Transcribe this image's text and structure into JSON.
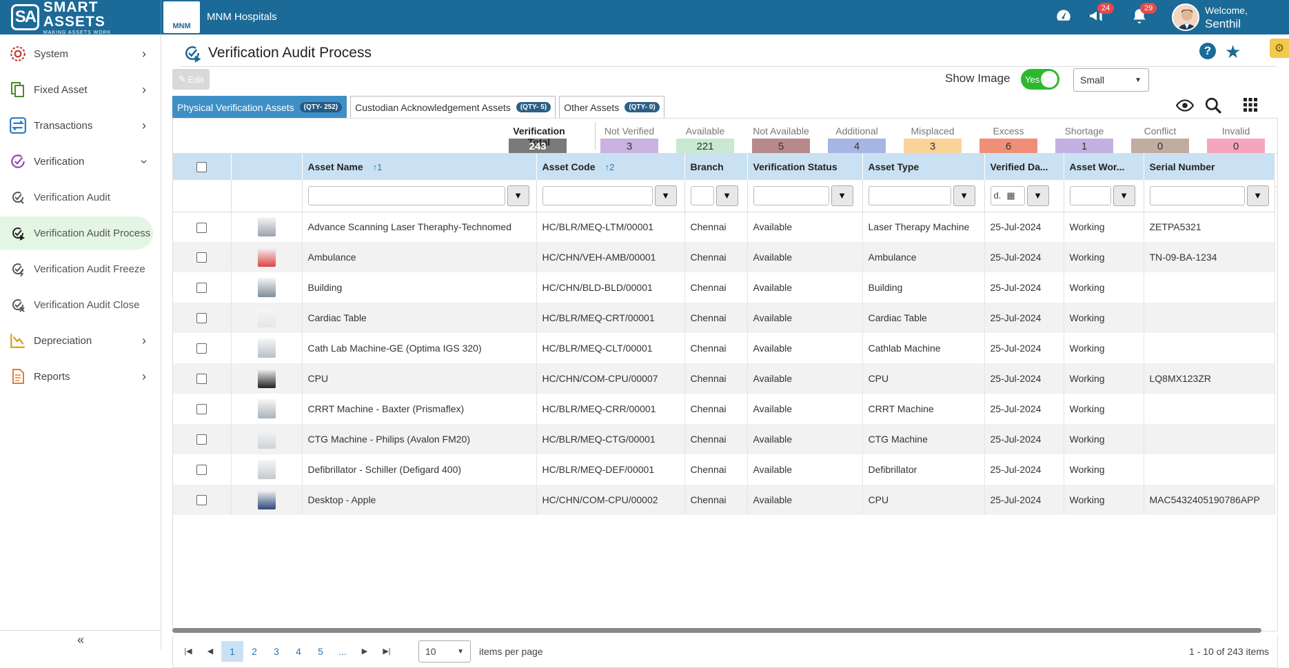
{
  "app": {
    "logo_main": "SMART ASSETS",
    "logo_mark": "SA",
    "logo_tagline": "MAKING ASSETS WORK",
    "hospital_logo_text": "MNM",
    "hospital_name": "MNM Hospitals",
    "announcements_count": "24",
    "notifications_count": "29",
    "welcome": "Welcome,",
    "user_name": "Senthil"
  },
  "sidebar": {
    "items": [
      {
        "label": "System",
        "icon": "system-icon",
        "color": "#c0392b"
      },
      {
        "label": "Fixed Asset",
        "icon": "fixed-asset-icon",
        "color": "#4a8a2a"
      },
      {
        "label": "Transactions",
        "icon": "transactions-icon",
        "color": "#2a78b8"
      },
      {
        "label": "Verification",
        "icon": "verification-icon",
        "color": "#8e44ad"
      },
      {
        "label": "Verification Audit",
        "icon": "verification-audit-icon"
      },
      {
        "label": "Verification Audit Process",
        "icon": "verification-audit-process-icon"
      },
      {
        "label": "Verification Audit Freeze",
        "icon": "verification-audit-freeze-icon"
      },
      {
        "label": "Verification Audit Close",
        "icon": "verification-audit-close-icon"
      },
      {
        "label": "Depreciation",
        "icon": "depreciation-icon",
        "color": "#d4a017"
      },
      {
        "label": "Reports",
        "icon": "reports-icon",
        "color": "#e07b39"
      }
    ],
    "collapse_label": "«"
  },
  "page": {
    "title": "Verification Audit Process",
    "edit_label": "Edit",
    "show_image_label": "Show Image",
    "toggle_label": "Yes",
    "size_value": "Small"
  },
  "tabs": [
    {
      "label": "Physical Verification Assets",
      "qty": "(QTY- 252)"
    },
    {
      "label": "Custodian Acknowledgement Assets",
      "qty": "(QTY- 5)"
    },
    {
      "label": "Other Assets",
      "qty": "(QTY- 0)"
    }
  ],
  "summary": {
    "total_label": "Verification Total",
    "total_value": "243",
    "stats": [
      {
        "label": "Not Verified",
        "value": "3",
        "color": "#c9b3e0"
      },
      {
        "label": "Available",
        "value": "221",
        "color": "#c8e8cf"
      },
      {
        "label": "Not Available",
        "value": "5",
        "color": "#b7898a"
      },
      {
        "label": "Additional",
        "value": "4",
        "color": "#a7b5e3"
      },
      {
        "label": "Misplaced",
        "value": "3",
        "color": "#f9d39a"
      },
      {
        "label": "Excess",
        "value": "6",
        "color": "#f08f78"
      },
      {
        "label": "Shortage",
        "value": "1",
        "color": "#c3b0e0"
      },
      {
        "label": "Conflict",
        "value": "0",
        "color": "#c0aca0"
      },
      {
        "label": "Invalid",
        "value": "0",
        "color": "#f5a6bd"
      }
    ]
  },
  "table": {
    "columns": [
      "Asset Name",
      "Asset Code",
      "Branch",
      "Verification Status",
      "Asset Type",
      "Verified Da...",
      "Asset Wor...",
      "Serial Number"
    ],
    "sort_name": "↑1",
    "sort_code": "↑2",
    "date_filter_text": "d.",
    "rows": [
      {
        "name": "Advance Scanning Laser Theraphy-Technomed",
        "code": "HC/BLR/MEQ-LTM/00001",
        "branch": "Chennai",
        "status": "Available",
        "type": "Laser Therapy Machine",
        "date": "25-Jul-2024",
        "work": "Working",
        "serial": "ZETPA5321",
        "thumb": "#9aa3ad"
      },
      {
        "name": "Ambulance",
        "code": "HC/CHN/VEH-AMB/00001",
        "branch": "Chennai",
        "status": "Available",
        "type": "Ambulance",
        "date": "25-Jul-2024",
        "work": "Working",
        "serial": "TN-09-BA-1234",
        "thumb": "#d44"
      },
      {
        "name": "Building",
        "code": "HC/CHN/BLD-BLD/00001",
        "branch": "Chennai",
        "status": "Available",
        "type": "Building",
        "date": "25-Jul-2024",
        "work": "Working",
        "serial": "",
        "thumb": "#7f8c99"
      },
      {
        "name": "Cardiac Table",
        "code": "HC/BLR/MEQ-CRT/00001",
        "branch": "Chennai",
        "status": "Available",
        "type": "Cardiac Table",
        "date": "25-Jul-2024",
        "work": "Working",
        "serial": "",
        "thumb": "#e6e6e6"
      },
      {
        "name": "Cath Lab Machine-GE (Optima IGS 320)",
        "code": "HC/BLR/MEQ-CLT/00001",
        "branch": "Chennai",
        "status": "Available",
        "type": "Cathlab Machine",
        "date": "25-Jul-2024",
        "work": "Working",
        "serial": "",
        "thumb": "#b8c0c8"
      },
      {
        "name": "CPU",
        "code": "HC/CHN/COM-CPU/00007",
        "branch": "Chennai",
        "status": "Available",
        "type": "CPU",
        "date": "25-Jul-2024",
        "work": "Working",
        "serial": "LQ8MX123ZR",
        "thumb": "#222"
      },
      {
        "name": "CRRT Machine - Baxter (Prismaflex)",
        "code": "HC/BLR/MEQ-CRR/00001",
        "branch": "Chennai",
        "status": "Available",
        "type": "CRRT Machine",
        "date": "25-Jul-2024",
        "work": "Working",
        "serial": "",
        "thumb": "#a9b4bd"
      },
      {
        "name": "CTG Machine - Philips (Avalon FM20)",
        "code": "HC/BLR/MEQ-CTG/00001",
        "branch": "Chennai",
        "status": "Available",
        "type": "CTG Machine",
        "date": "25-Jul-2024",
        "work": "Working",
        "serial": "",
        "thumb": "#cfd3d6"
      },
      {
        "name": "Defibrillator - Schiller (Defigard 400)",
        "code": "HC/BLR/MEQ-DEF/00001",
        "branch": "Chennai",
        "status": "Available",
        "type": "Defibrillator",
        "date": "25-Jul-2024",
        "work": "Working",
        "serial": "",
        "thumb": "#c4c9cf"
      },
      {
        "name": "Desktop - Apple",
        "code": "HC/CHN/COM-CPU/00002",
        "branch": "Chennai",
        "status": "Available",
        "type": "CPU",
        "date": "25-Jul-2024",
        "work": "Working",
        "serial": "MAC5432405190786APP",
        "thumb": "#2c4a7a"
      }
    ]
  },
  "pager": {
    "pages": [
      "1",
      "2",
      "3",
      "4",
      "5",
      "..."
    ],
    "per_page": "10",
    "items_per_page": "items per page",
    "range": "1 - 10 of 243 items"
  }
}
